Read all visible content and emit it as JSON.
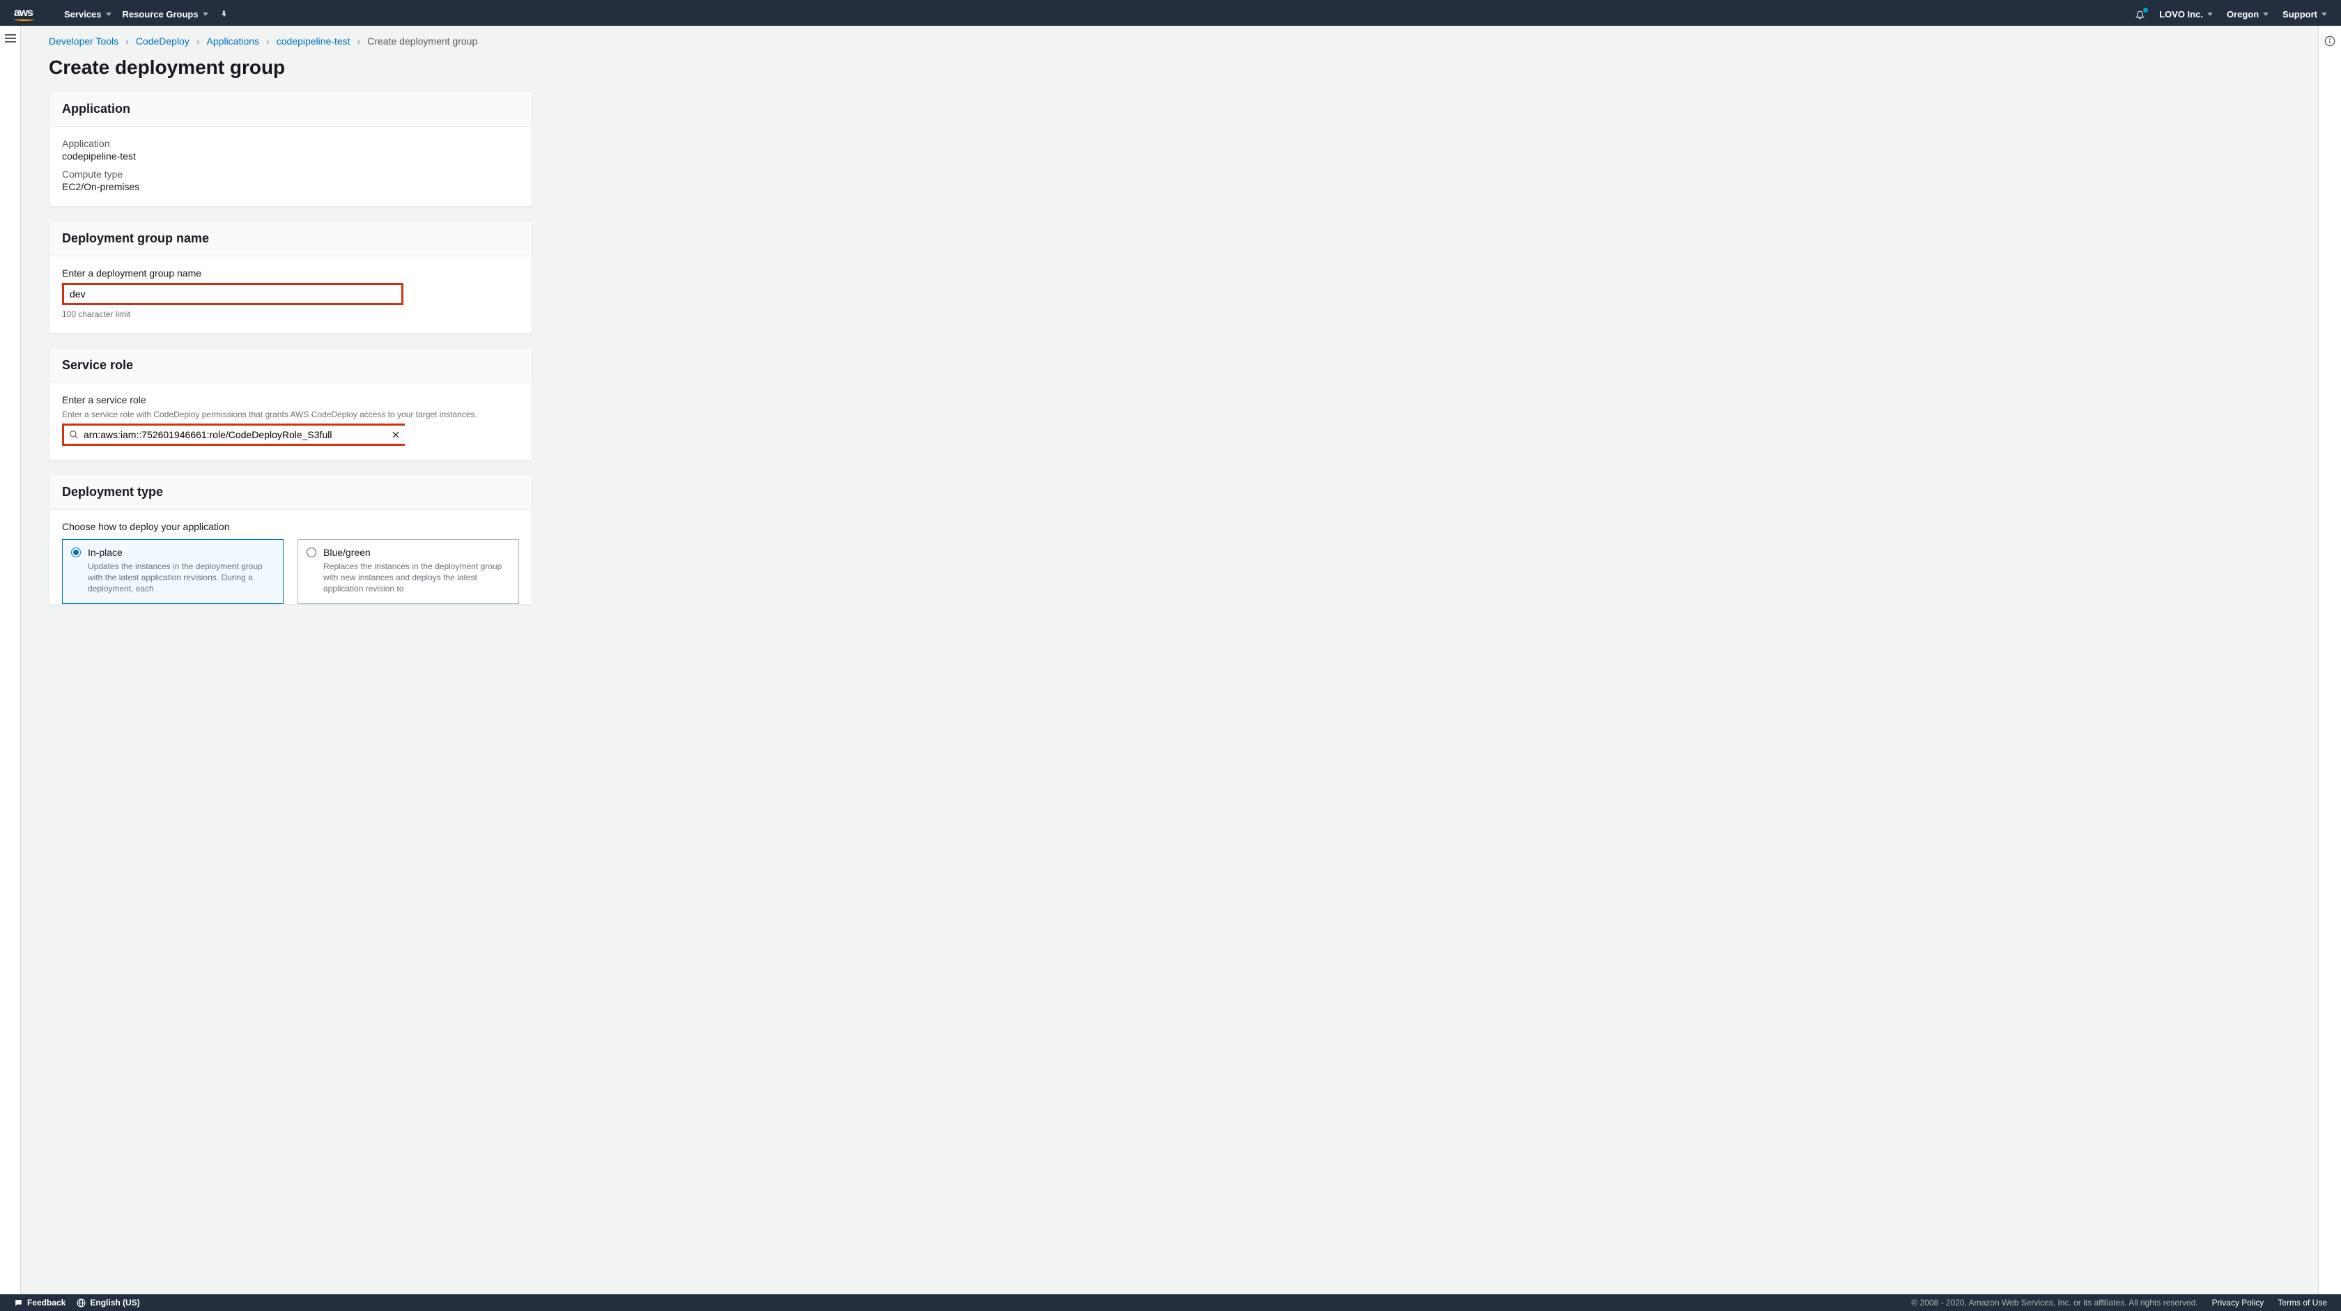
{
  "topbar": {
    "services": "Services",
    "resource_groups": "Resource Groups",
    "account": "LOVO Inc.",
    "region": "Oregon",
    "support": "Support"
  },
  "breadcrumb": {
    "items": [
      "Developer Tools",
      "CodeDeploy",
      "Applications",
      "codepipeline-test"
    ],
    "current": "Create deployment group"
  },
  "page_title": "Create deployment group",
  "application_panel": {
    "header": "Application",
    "app_label": "Application",
    "app_value": "codepipeline-test",
    "compute_label": "Compute type",
    "compute_value": "EC2/On-premises"
  },
  "dgname_panel": {
    "header": "Deployment group name",
    "label": "Enter a deployment group name",
    "value": "dev",
    "hint": "100 character limit"
  },
  "servicerole_panel": {
    "header": "Service role",
    "label": "Enter a service role",
    "desc": "Enter a service role with CodeDeploy permissions that grants AWS CodeDeploy access to your target instances.",
    "value": "arn:aws:iam::752601946661:role/CodeDeployRole_S3full"
  },
  "depltype_panel": {
    "header": "Deployment type",
    "choose_label": "Choose how to deploy your application",
    "options": [
      {
        "title": "In-place",
        "desc": "Updates the instances in the deployment group with the latest application revisions. During a deployment, each",
        "selected": true
      },
      {
        "title": "Blue/green",
        "desc": "Replaces the instances in the deployment group with new instances and deploys the latest application revision to",
        "selected": false
      }
    ]
  },
  "footer": {
    "feedback": "Feedback",
    "language": "English (US)",
    "copyright": "© 2008 - 2020, Amazon Web Services, Inc. or its affiliates. All rights reserved.",
    "privacy": "Privacy Policy",
    "terms": "Terms of Use"
  }
}
